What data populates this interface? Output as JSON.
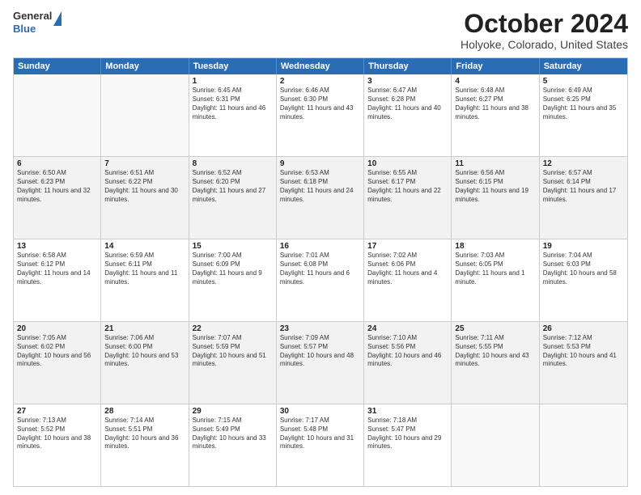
{
  "header": {
    "logo_general": "General",
    "logo_blue": "Blue",
    "title": "October 2024",
    "subtitle": "Holyoke, Colorado, United States"
  },
  "calendar": {
    "days": [
      "Sunday",
      "Monday",
      "Tuesday",
      "Wednesday",
      "Thursday",
      "Friday",
      "Saturday"
    ],
    "weeks": [
      [
        {
          "day": "",
          "text": ""
        },
        {
          "day": "",
          "text": ""
        },
        {
          "day": "1",
          "text": "Sunrise: 6:45 AM\nSunset: 6:31 PM\nDaylight: 11 hours and 46 minutes."
        },
        {
          "day": "2",
          "text": "Sunrise: 6:46 AM\nSunset: 6:30 PM\nDaylight: 11 hours and 43 minutes."
        },
        {
          "day": "3",
          "text": "Sunrise: 6:47 AM\nSunset: 6:28 PM\nDaylight: 11 hours and 40 minutes."
        },
        {
          "day": "4",
          "text": "Sunrise: 6:48 AM\nSunset: 6:27 PM\nDaylight: 11 hours and 38 minutes."
        },
        {
          "day": "5",
          "text": "Sunrise: 6:49 AM\nSunset: 6:25 PM\nDaylight: 11 hours and 35 minutes."
        }
      ],
      [
        {
          "day": "6",
          "text": "Sunrise: 6:50 AM\nSunset: 6:23 PM\nDaylight: 11 hours and 32 minutes."
        },
        {
          "day": "7",
          "text": "Sunrise: 6:51 AM\nSunset: 6:22 PM\nDaylight: 11 hours and 30 minutes."
        },
        {
          "day": "8",
          "text": "Sunrise: 6:52 AM\nSunset: 6:20 PM\nDaylight: 11 hours and 27 minutes."
        },
        {
          "day": "9",
          "text": "Sunrise: 6:53 AM\nSunset: 6:18 PM\nDaylight: 11 hours and 24 minutes."
        },
        {
          "day": "10",
          "text": "Sunrise: 6:55 AM\nSunset: 6:17 PM\nDaylight: 11 hours and 22 minutes."
        },
        {
          "day": "11",
          "text": "Sunrise: 6:56 AM\nSunset: 6:15 PM\nDaylight: 11 hours and 19 minutes."
        },
        {
          "day": "12",
          "text": "Sunrise: 6:57 AM\nSunset: 6:14 PM\nDaylight: 11 hours and 17 minutes."
        }
      ],
      [
        {
          "day": "13",
          "text": "Sunrise: 6:58 AM\nSunset: 6:12 PM\nDaylight: 11 hours and 14 minutes."
        },
        {
          "day": "14",
          "text": "Sunrise: 6:59 AM\nSunset: 6:11 PM\nDaylight: 11 hours and 11 minutes."
        },
        {
          "day": "15",
          "text": "Sunrise: 7:00 AM\nSunset: 6:09 PM\nDaylight: 11 hours and 9 minutes."
        },
        {
          "day": "16",
          "text": "Sunrise: 7:01 AM\nSunset: 6:08 PM\nDaylight: 11 hours and 6 minutes."
        },
        {
          "day": "17",
          "text": "Sunrise: 7:02 AM\nSunset: 6:06 PM\nDaylight: 11 hours and 4 minutes."
        },
        {
          "day": "18",
          "text": "Sunrise: 7:03 AM\nSunset: 6:05 PM\nDaylight: 11 hours and 1 minute."
        },
        {
          "day": "19",
          "text": "Sunrise: 7:04 AM\nSunset: 6:03 PM\nDaylight: 10 hours and 58 minutes."
        }
      ],
      [
        {
          "day": "20",
          "text": "Sunrise: 7:05 AM\nSunset: 6:02 PM\nDaylight: 10 hours and 56 minutes."
        },
        {
          "day": "21",
          "text": "Sunrise: 7:06 AM\nSunset: 6:00 PM\nDaylight: 10 hours and 53 minutes."
        },
        {
          "day": "22",
          "text": "Sunrise: 7:07 AM\nSunset: 5:59 PM\nDaylight: 10 hours and 51 minutes."
        },
        {
          "day": "23",
          "text": "Sunrise: 7:09 AM\nSunset: 5:57 PM\nDaylight: 10 hours and 48 minutes."
        },
        {
          "day": "24",
          "text": "Sunrise: 7:10 AM\nSunset: 5:56 PM\nDaylight: 10 hours and 46 minutes."
        },
        {
          "day": "25",
          "text": "Sunrise: 7:11 AM\nSunset: 5:55 PM\nDaylight: 10 hours and 43 minutes."
        },
        {
          "day": "26",
          "text": "Sunrise: 7:12 AM\nSunset: 5:53 PM\nDaylight: 10 hours and 41 minutes."
        }
      ],
      [
        {
          "day": "27",
          "text": "Sunrise: 7:13 AM\nSunset: 5:52 PM\nDaylight: 10 hours and 38 minutes."
        },
        {
          "day": "28",
          "text": "Sunrise: 7:14 AM\nSunset: 5:51 PM\nDaylight: 10 hours and 36 minutes."
        },
        {
          "day": "29",
          "text": "Sunrise: 7:15 AM\nSunset: 5:49 PM\nDaylight: 10 hours and 33 minutes."
        },
        {
          "day": "30",
          "text": "Sunrise: 7:17 AM\nSunset: 5:48 PM\nDaylight: 10 hours and 31 minutes."
        },
        {
          "day": "31",
          "text": "Sunrise: 7:18 AM\nSunset: 5:47 PM\nDaylight: 10 hours and 29 minutes."
        },
        {
          "day": "",
          "text": ""
        },
        {
          "day": "",
          "text": ""
        }
      ]
    ]
  }
}
